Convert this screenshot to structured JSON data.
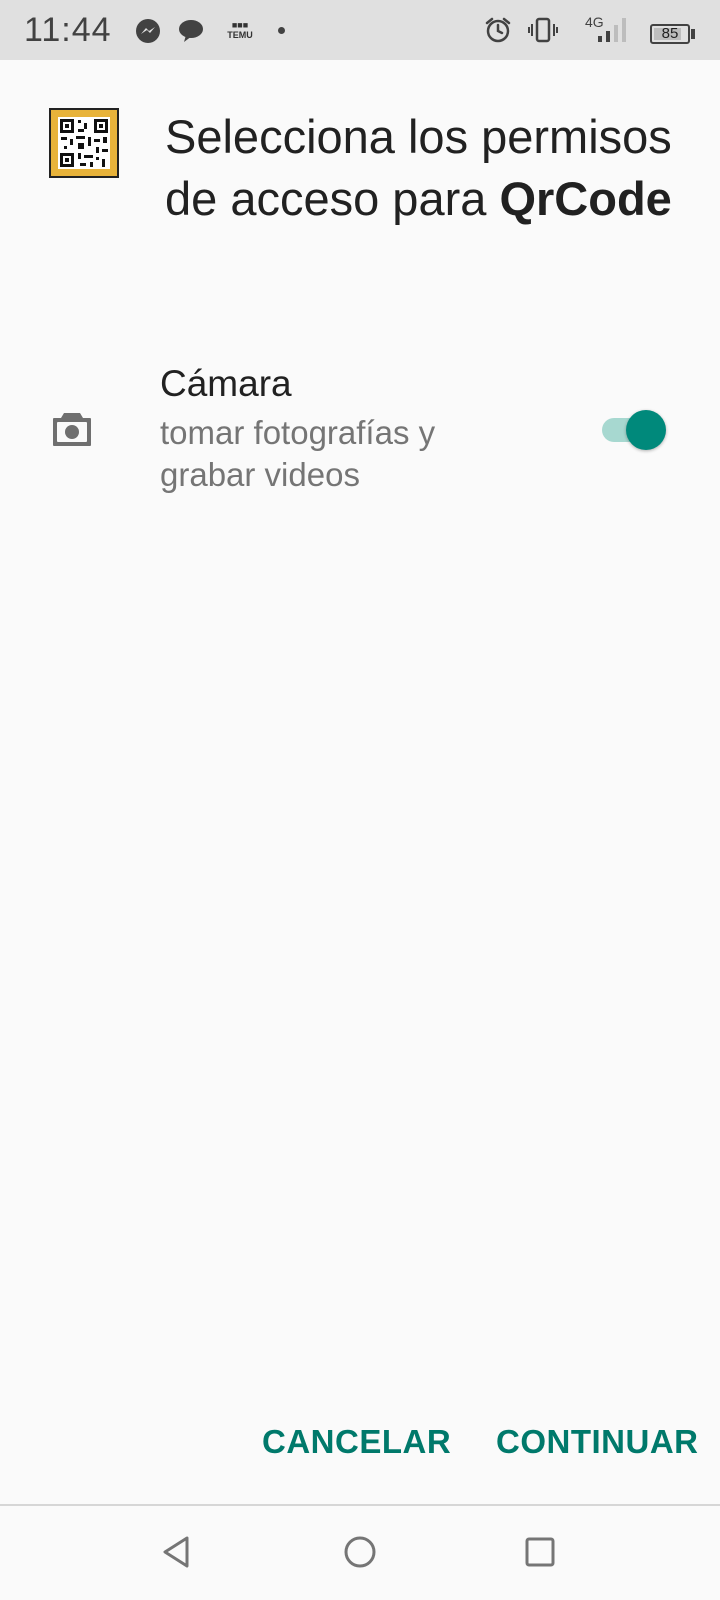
{
  "status_bar": {
    "time": "11:44",
    "notification_icons": [
      "messenger-icon",
      "chat-bubble-icon",
      "temu-icon",
      "more-notifications-dot"
    ],
    "temu_label": "TEMU",
    "network_label": "4G",
    "battery_percent": "85",
    "battery_level": 0.85,
    "system_icons": [
      "alarm-icon",
      "vibrate-icon",
      "signal-icon",
      "battery-icon"
    ]
  },
  "header": {
    "app_icon": "qr-code-icon",
    "title_prefix": "Selecciona los permisos de acceso para ",
    "app_name": "QrCode"
  },
  "permissions": [
    {
      "icon": "camera-icon",
      "name": "Cámara",
      "description": "tomar fotografías y grabar videos",
      "enabled": true
    }
  ],
  "actions": {
    "cancel_label": "CANCELAR",
    "continue_label": "CONTINUAR"
  },
  "navigation": {
    "buttons": [
      "back-icon",
      "home-icon",
      "recents-icon"
    ]
  },
  "colors": {
    "accent": "#00796b",
    "toggle_thumb": "#00897b",
    "toggle_track": "#a7d8d0",
    "background": "#fafafa",
    "status_bar": "#e0e0e0"
  }
}
